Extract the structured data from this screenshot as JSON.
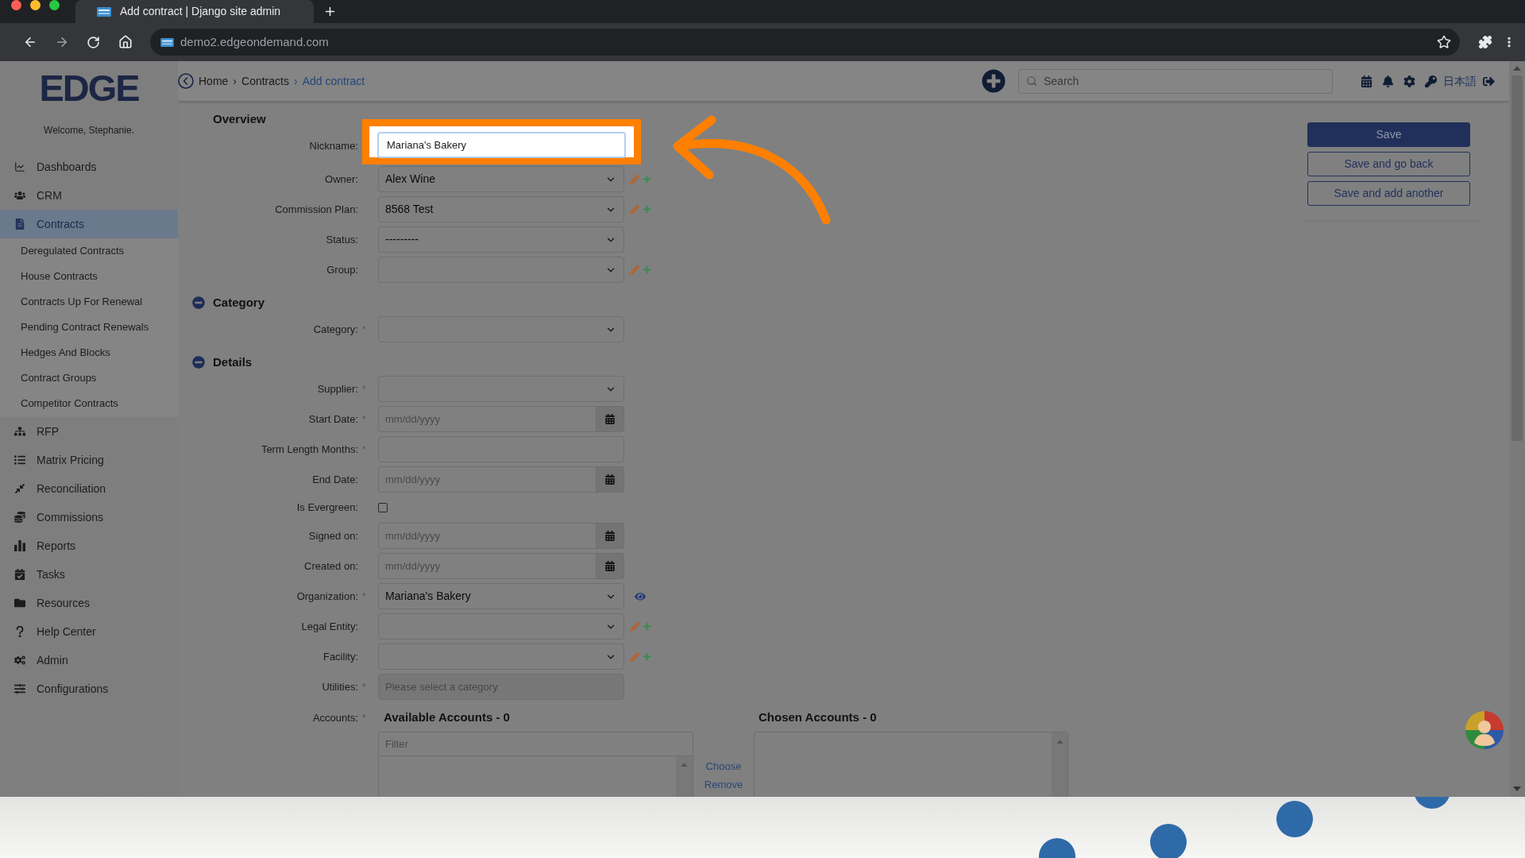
{
  "browser": {
    "tab_title": "Add contract | Django site admin",
    "url": "demo2.edgeondemand.com"
  },
  "sidebar": {
    "logo": "EDGE",
    "welcome": "Welcome, Stephanie.",
    "items": [
      {
        "label": "Dashboards",
        "selected": false
      },
      {
        "label": "CRM",
        "selected": false
      },
      {
        "label": "Contracts",
        "selected": true,
        "expanded": true,
        "children": [
          {
            "label": "Deregulated Contracts",
            "selected": false
          },
          {
            "label": "House Contracts",
            "selected": false
          },
          {
            "label": "Contracts Up For Renewal",
            "selected": false
          },
          {
            "label": "Pending Contract Renewals",
            "selected": false
          },
          {
            "label": "Hedges And Blocks",
            "selected": false
          },
          {
            "label": "Contract Groups",
            "selected": false
          },
          {
            "label": "Competitor Contracts",
            "selected": false
          }
        ]
      },
      {
        "label": "RFP",
        "selected": false
      },
      {
        "label": "Matrix Pricing",
        "selected": false
      },
      {
        "label": "Reconciliation",
        "selected": false
      },
      {
        "label": "Commissions",
        "selected": false
      },
      {
        "label": "Reports",
        "selected": false
      },
      {
        "label": "Tasks",
        "selected": false
      },
      {
        "label": "Resources",
        "selected": false
      },
      {
        "label": "Help Center",
        "selected": false
      },
      {
        "label": "Admin",
        "selected": false
      },
      {
        "label": "Configurations",
        "selected": false
      }
    ]
  },
  "header": {
    "breadcrumbs": {
      "separator": "›",
      "items": [
        {
          "label": "Home",
          "current": false
        },
        {
          "label": "Contracts",
          "current": false
        },
        {
          "label": "Add contract",
          "current": true
        }
      ]
    },
    "search": {
      "placeholder": "Search"
    },
    "language": "日本語"
  },
  "actions": [
    {
      "label": "Save",
      "primary": true
    },
    {
      "label": "Save and go back",
      "primary": false
    },
    {
      "label": "Save and add another",
      "primary": false
    }
  ],
  "form": {
    "required_mark": "*",
    "sections": [
      {
        "title": "Overview",
        "collapsible": false,
        "fields": [
          {
            "kind": "text",
            "label": "Nickname:",
            "required": false,
            "value": "Mariana's Bakery",
            "highlighted": true
          },
          {
            "kind": "select",
            "label": "Owner:",
            "required": false,
            "value": "Alex Wine",
            "addons": [
              {
                "kind": "edit"
              },
              {
                "kind": "add"
              }
            ],
            "highlighted": false
          },
          {
            "kind": "select",
            "label": "Commission Plan:",
            "required": false,
            "value": "8568 Test",
            "addons": [
              {
                "kind": "edit"
              },
              {
                "kind": "add"
              }
            ],
            "highlighted": false
          },
          {
            "kind": "select",
            "label": "Status:",
            "required": false,
            "value": "---------",
            "highlighted": false
          },
          {
            "kind": "select",
            "label": "Group:",
            "required": false,
            "addons": [
              {
                "kind": "edit"
              },
              {
                "kind": "add"
              }
            ],
            "highlighted": false
          }
        ]
      },
      {
        "title": "Category",
        "collapsible": true,
        "expanded": true,
        "fields": [
          {
            "kind": "select",
            "label": "Category:",
            "required": true,
            "highlighted": false
          }
        ]
      },
      {
        "title": "Details",
        "collapsible": true,
        "expanded": true,
        "fields": [
          {
            "kind": "select",
            "label": "Supplier:",
            "required": true,
            "highlighted": false
          },
          {
            "kind": "date",
            "label": "Start Date:",
            "required": true,
            "placeholder": "mm/dd/yyyy",
            "highlighted": false
          },
          {
            "kind": "text",
            "label": "Term Length Months:",
            "required": true,
            "highlighted": false
          },
          {
            "kind": "date",
            "label": "End Date:",
            "required": false,
            "placeholder": "mm/dd/yyyy",
            "highlighted": false
          },
          {
            "kind": "checkbox",
            "label": "Is Evergreen:",
            "required": false,
            "checked": false,
            "highlighted": false
          },
          {
            "kind": "date",
            "label": "Signed on:",
            "required": false,
            "placeholder": "mm/dd/yyyy",
            "highlighted": false
          },
          {
            "kind": "date",
            "label": "Created on:",
            "required": false,
            "placeholder": "mm/dd/yyyy",
            "highlighted": false
          },
          {
            "kind": "select",
            "label": "Organization:",
            "required": true,
            "value": "Mariana's Bakery",
            "addons": [
              {
                "kind": "view"
              }
            ],
            "highlighted": false
          },
          {
            "kind": "select",
            "label": "Legal Entity:",
            "required": false,
            "addons": [
              {
                "kind": "edit"
              },
              {
                "kind": "add"
              }
            ],
            "highlighted": false
          },
          {
            "kind": "select",
            "label": "Facility:",
            "required": false,
            "addons": [
              {
                "kind": "edit"
              },
              {
                "kind": "add"
              }
            ],
            "highlighted": false
          },
          {
            "kind": "readonly",
            "label": "Utilities:",
            "required": true,
            "placeholder": "Please select a category",
            "highlighted": false
          },
          {
            "kind": "dual_list",
            "label": "Accounts:",
            "required": true,
            "available_title": "Available Accounts - 0",
            "filter_placeholder": "Filter",
            "choose": "Choose",
            "remove": "Remove",
            "chosen_title": "Chosen Accounts - 0",
            "highlighted": false
          }
        ]
      }
    ]
  }
}
